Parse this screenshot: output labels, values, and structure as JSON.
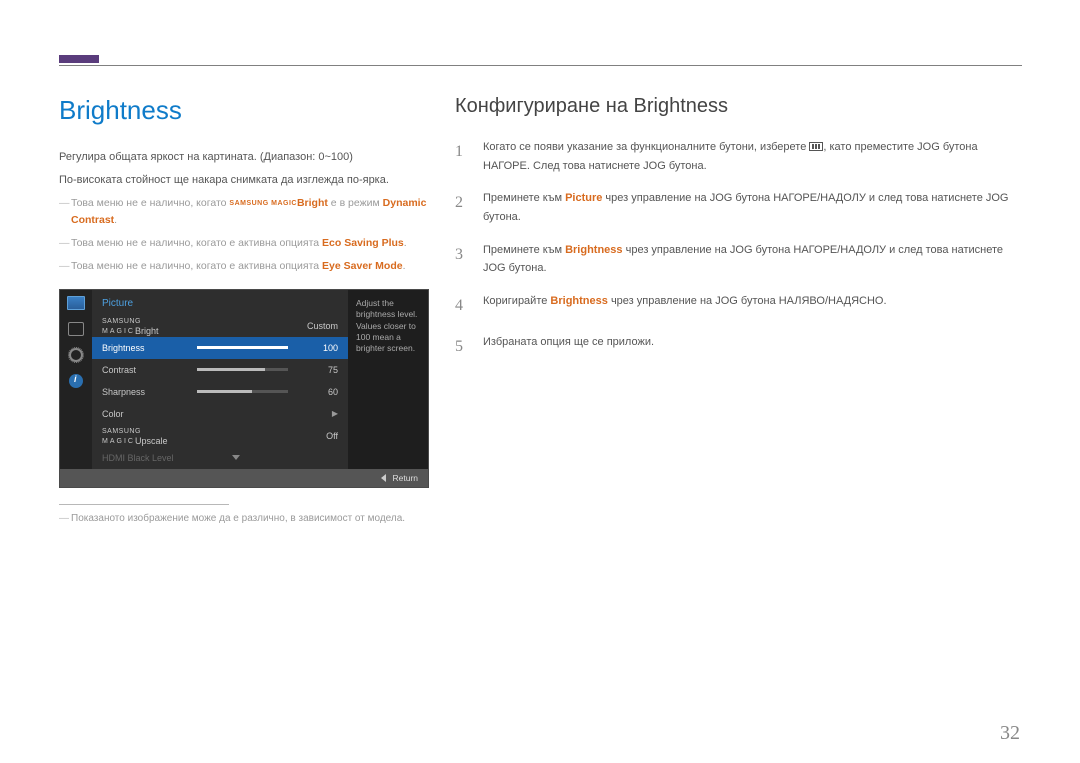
{
  "page_number": "32",
  "left": {
    "title": "Brightness",
    "desc1": "Регулира общата яркост на картината. (Диапазон: 0~100)",
    "desc2": "По-високата стойност ще накара снимката да изглежда по-ярка.",
    "note1_a": "Това меню не е налично, когато ",
    "note1_magic": "SAMSUNG MAGIC",
    "note1_b": "Bright",
    "note1_c": " е в режим ",
    "note1_d": "Dynamic Contrast",
    "note1_e": ".",
    "note2_a": "Това меню не е налично, когато е активна опцията ",
    "note2_b": "Eco Saving Plus",
    "note2_c": ".",
    "note3_a": "Това меню не е налично, когато е активна опцията ",
    "note3_b": "Eye Saver Mode",
    "note3_c": ".",
    "caption": "Показаното изображение може да е различно, в зависимост от модела."
  },
  "osd": {
    "title": "Picture",
    "help": "Adjust the brightness level. Values closer to 100 mean a brighter screen.",
    "footer": "Return",
    "magic_prefix": "SAMSUNG",
    "magic_line": "MAGIC",
    "rows": {
      "magicbright": {
        "label": "Bright",
        "value": "Custom"
      },
      "brightness": {
        "label": "Brightness",
        "value": "100"
      },
      "contrast": {
        "label": "Contrast",
        "value": "75"
      },
      "sharpness": {
        "label": "Sharpness",
        "value": "60"
      },
      "color": {
        "label": "Color"
      },
      "upscale": {
        "label": "Upscale",
        "value": "Off"
      },
      "hdmi": {
        "label": "HDMI Black Level"
      }
    }
  },
  "right": {
    "title": "Конфигуриране на Brightness",
    "step1_a": "Когато се появи указание за функционалните бутони, изберете ",
    "step1_b": ", като преместите JOG бутона НАГОРЕ. След това натиснете JOG бутона.",
    "step2_a": "Преминете към ",
    "step2_b": "Picture",
    "step2_c": " чрез управление на JOG бутона НАГОРЕ/НАДОЛУ и след това натиснете JOG бутона.",
    "step3_a": "Преминете към ",
    "step3_b": "Brightness",
    "step3_c": " чрез управление на JOG бутона НАГОРЕ/НАДОЛУ и след това натиснете JOG бутона.",
    "step4_a": "Коригирайте ",
    "step4_b": "Brightness",
    "step4_c": " чрез управление на JOG бутона НАЛЯВО/НАДЯСНО.",
    "step5": "Избраната опция ще се приложи.",
    "nums": {
      "n1": "1",
      "n2": "2",
      "n3": "3",
      "n4": "4",
      "n5": "5"
    }
  }
}
